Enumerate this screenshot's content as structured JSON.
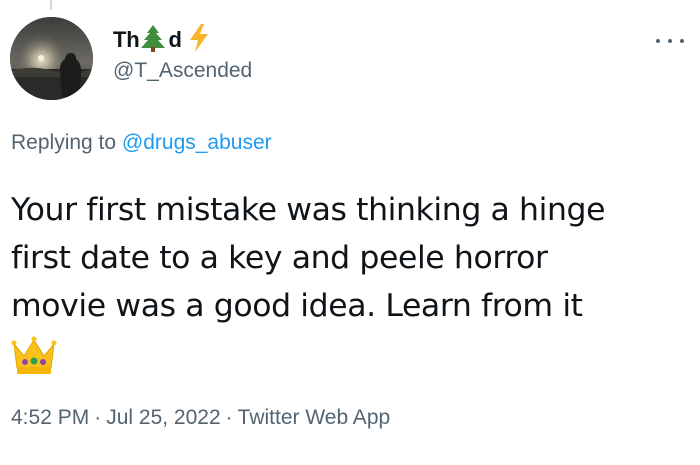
{
  "author": {
    "name_start": "Th",
    "name_end": "d",
    "name_icons": [
      "evergreen-tree-icon",
      "lightning-bolt-icon"
    ],
    "handle": "@T_Ascended",
    "avatar": "profile-photo-sunset-silhouette"
  },
  "reply": {
    "prefix": "Replying to ",
    "target": "@drugs_abuser"
  },
  "tweet": {
    "lines": [
      "Your first mistake was thinking a hinge",
      "first date to a key and peele horror",
      "movie was a good idea. Learn from it"
    ],
    "emoji": "crown-icon"
  },
  "meta": {
    "time": "4:52 PM",
    "separator": "·",
    "date": "Jul 25, 2022",
    "source": "Twitter Web App"
  },
  "colors": {
    "text": "#0f1419",
    "secondary": "#536471",
    "link": "#1d9bf0"
  }
}
